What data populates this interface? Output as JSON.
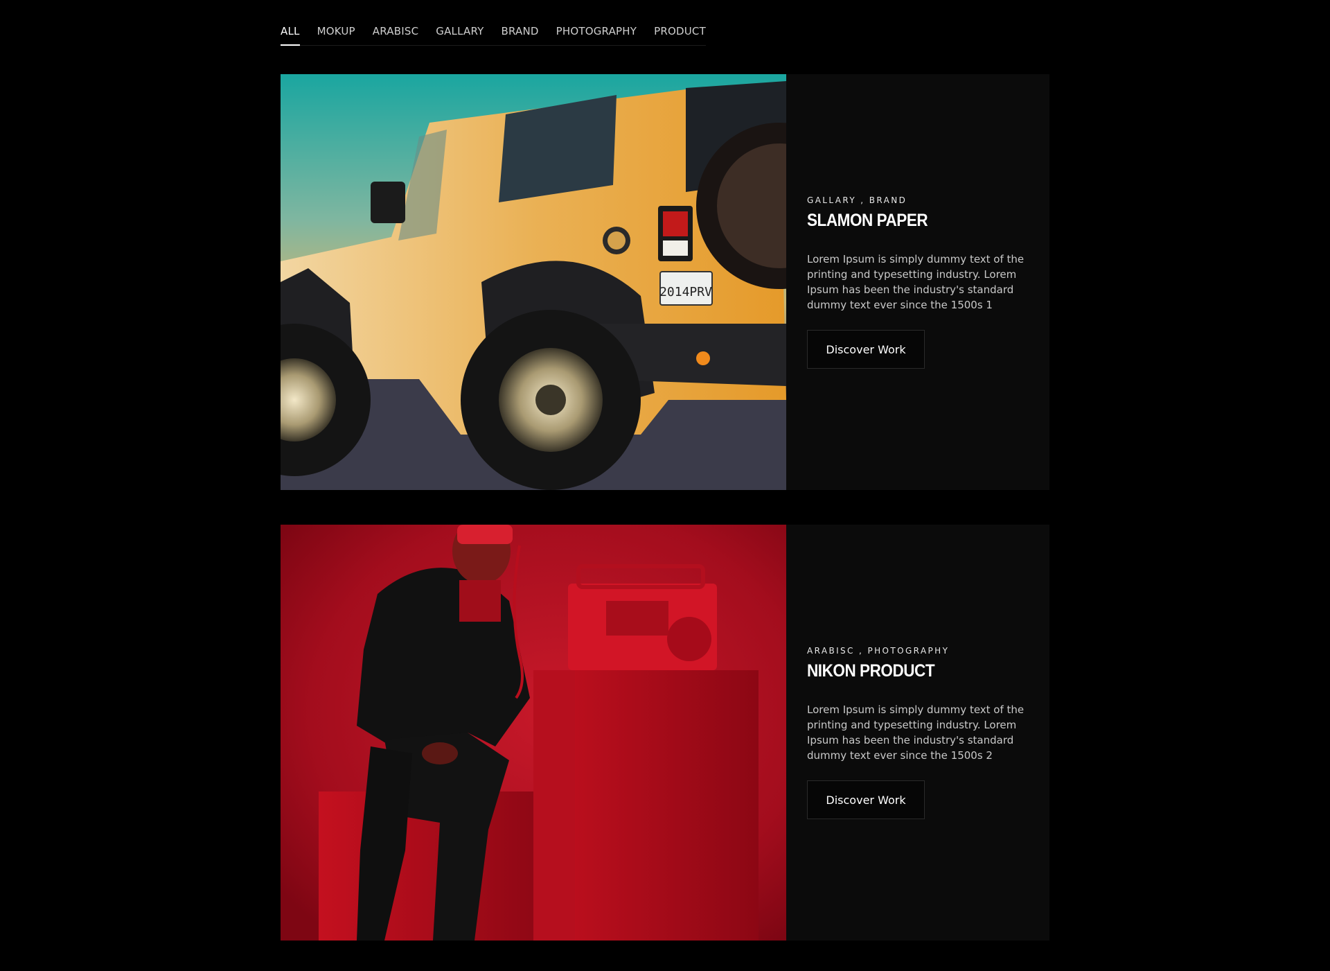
{
  "filters": {
    "items": [
      "ALL",
      "MOKUP",
      "ARABISC",
      "GALLARY",
      "BRAND",
      "PHOTOGRAPHY",
      "PRODUCT"
    ],
    "active": "ALL"
  },
  "projects": [
    {
      "tags": "GALLARY , BRAND",
      "title": "SLAMON PAPER",
      "description": "Lorem Ipsum is simply dummy text of the printing and typesetting industry. Lorem Ipsum has been the industry's standard dummy text ever since the 1500s 1",
      "button_label": "Discover Work",
      "image": {
        "subject": "orange off-road jeep",
        "plate_text": "2014PRV"
      }
    },
    {
      "tags": "ARABISC , PHOTOGRAPHY",
      "title": "NIKON PRODUCT",
      "description": "Lorem Ipsum is simply dummy text of the printing and typesetting industry. Lorem Ipsum has been the industry's standard dummy text ever since the 1500s 2",
      "button_label": "Discover Work",
      "image": {
        "subject": "man in black suit with red boombox on red background"
      }
    }
  ],
  "colors": {
    "background": "#000000",
    "panel": "#0b0b0b",
    "text_muted": "#c9c9c9",
    "accent_red": "#b20a1a",
    "jeep_orange": "#e8a12e"
  }
}
